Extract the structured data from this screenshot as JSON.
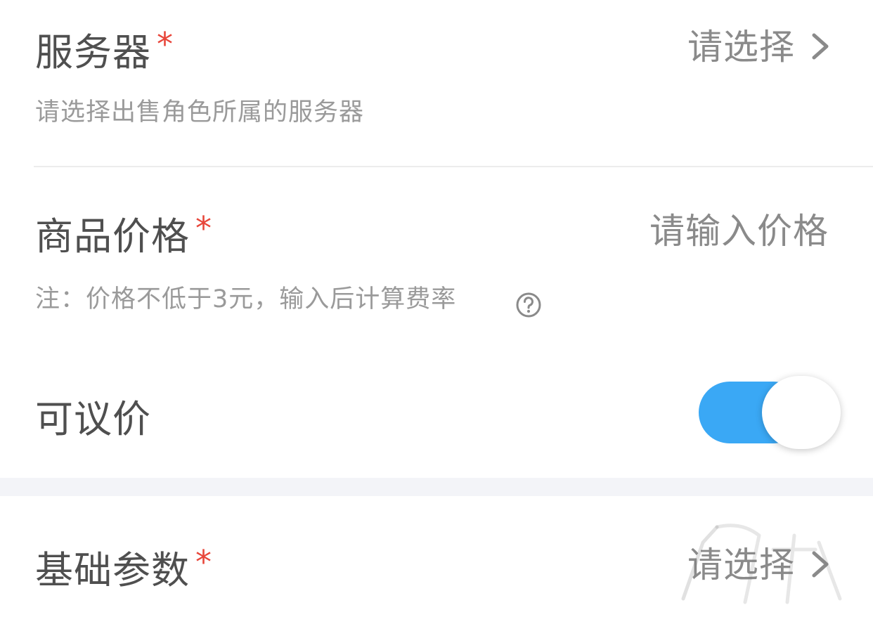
{
  "server_row": {
    "label": "服务器",
    "required_mark": "*",
    "placeholder": "请选择",
    "hint": "请选择出售角色所属的服务器",
    "chevron_icon": "chevron-right-icon"
  },
  "price_row": {
    "label": "商品价格",
    "required_mark": "*",
    "placeholder": "请输入价格",
    "hint": "注：价格不低于3元，输入后计算费率",
    "help_icon": "question-circle-icon"
  },
  "negotiable_row": {
    "label": "可议价",
    "toggle_on": true,
    "accent_color": "#3aa8f5"
  },
  "params_row": {
    "label": "基础参数",
    "required_mark": "*",
    "placeholder": "请选择",
    "chevron_icon": "chevron-right-icon"
  },
  "colors": {
    "required": "#e8463a",
    "label": "#4f4f4f",
    "placeholder": "#8a8a8a",
    "hint": "#9a9a9a"
  }
}
